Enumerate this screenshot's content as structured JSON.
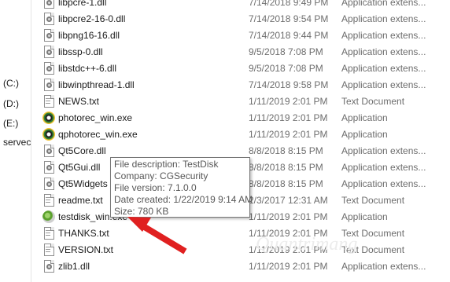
{
  "nav": {
    "items": [
      {
        "label": "(C:)"
      },
      {
        "label": "(D:)"
      },
      {
        "label": "(E:)"
      },
      {
        "label": "servec"
      }
    ]
  },
  "files": [
    {
      "name": "libpcre-1.dll",
      "date": "7/14/2018 9:49 PM",
      "type": "Application extens...",
      "icon": "dll-icon"
    },
    {
      "name": "libpcre2-16-0.dll",
      "date": "7/14/2018 9:54 PM",
      "type": "Application extens...",
      "icon": "dll-icon"
    },
    {
      "name": "libpng16-16.dll",
      "date": "7/14/2018 9:44 PM",
      "type": "Application extens...",
      "icon": "dll-icon"
    },
    {
      "name": "libssp-0.dll",
      "date": "9/5/2018 7:08 PM",
      "type": "Application extens...",
      "icon": "dll-icon"
    },
    {
      "name": "libstdc++-6.dll",
      "date": "9/5/2018 7:08 PM",
      "type": "Application extens...",
      "icon": "dll-icon"
    },
    {
      "name": "libwinpthread-1.dll",
      "date": "7/14/2018 9:58 PM",
      "type": "Application extens...",
      "icon": "dll-icon"
    },
    {
      "name": "NEWS.txt",
      "date": "1/11/2019 2:01 PM",
      "type": "Text Document",
      "icon": "text-file-icon"
    },
    {
      "name": "photorec_win.exe",
      "date": "1/11/2019 2:01 PM",
      "type": "Application",
      "icon": "photorec-app-icon"
    },
    {
      "name": "qphotorec_win.exe",
      "date": "1/11/2019 2:01 PM",
      "type": "Application",
      "icon": "photorec-app-icon"
    },
    {
      "name": "Qt5Core.dll",
      "date": "8/8/2018 8:15 PM",
      "type": "Application extens...",
      "icon": "dll-icon"
    },
    {
      "name": "Qt5Gui.dll",
      "date": "8/8/2018 8:15 PM",
      "type": "Application extens...",
      "icon": "dll-icon"
    },
    {
      "name": "Qt5Widgets",
      "date": "8/8/2018 8:15 PM",
      "type": "Application extens...",
      "icon": "dll-icon"
    },
    {
      "name": "readme.txt",
      "date": "2/3/2017 12:31 AM",
      "type": "Text Document",
      "icon": "text-file-icon"
    },
    {
      "name": "testdisk_win.exe",
      "date": "1/11/2019 2:01 PM",
      "type": "Application",
      "icon": "testdisk-app-icon"
    },
    {
      "name": "THANKS.txt",
      "date": "1/11/2019 2:01 PM",
      "type": "Text Document",
      "icon": "text-file-icon"
    },
    {
      "name": "VERSION.txt",
      "date": "1/11/2019 2:01 PM",
      "type": "Text Document",
      "icon": "text-file-icon"
    },
    {
      "name": "zlib1.dll",
      "date": "1/11/2019 2:01 PM",
      "type": "Application extens...",
      "icon": "dll-icon"
    }
  ],
  "tooltip": {
    "description": "File description: TestDisk",
    "company": "Company: CGSecurity",
    "version": "File version: 7.1.0.0",
    "created": "Date created: 1/22/2019 9:14 AM",
    "size": "Size: 780 KB"
  },
  "watermark": "Quantrimang",
  "colors": {
    "arrow": "#e02020",
    "secondary_text": "#6d6d6d",
    "tooltip_border": "#767676"
  }
}
